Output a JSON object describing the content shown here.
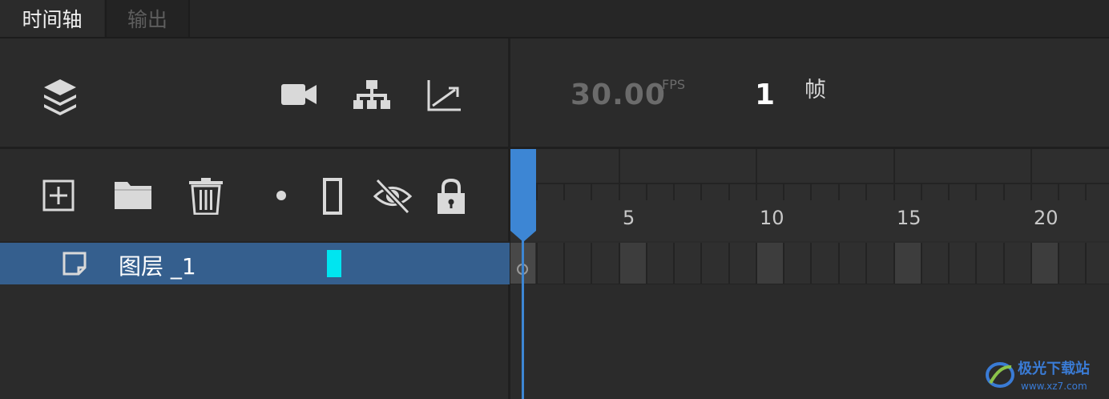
{
  "tabs": [
    {
      "label": "时间轴",
      "active": true
    },
    {
      "label": "输出",
      "active": false
    }
  ],
  "toolbar": {
    "icons": [
      "layers-icon",
      "camera-icon",
      "hierarchy-icon",
      "graph-icon"
    ]
  },
  "fps": {
    "value": "30.00",
    "unit": "FPS"
  },
  "frame": {
    "value": "1",
    "unit": "帧"
  },
  "layer_tools": {
    "icons": [
      "add-layer-icon",
      "folder-icon",
      "trash-icon",
      "dot-icon",
      "outline-icon",
      "hide-icon",
      "lock-icon"
    ]
  },
  "ruler": {
    "labels": [
      "5",
      "10",
      "15",
      "20"
    ]
  },
  "layers": [
    {
      "name": "图层 _1",
      "color": "#00e5f0",
      "selected": true
    }
  ],
  "colors": {
    "accent": "#3d86d4",
    "selected_row": "#355f8e"
  },
  "watermark": {
    "text": "极光下载站",
    "url_text": "www.xz7.com"
  }
}
